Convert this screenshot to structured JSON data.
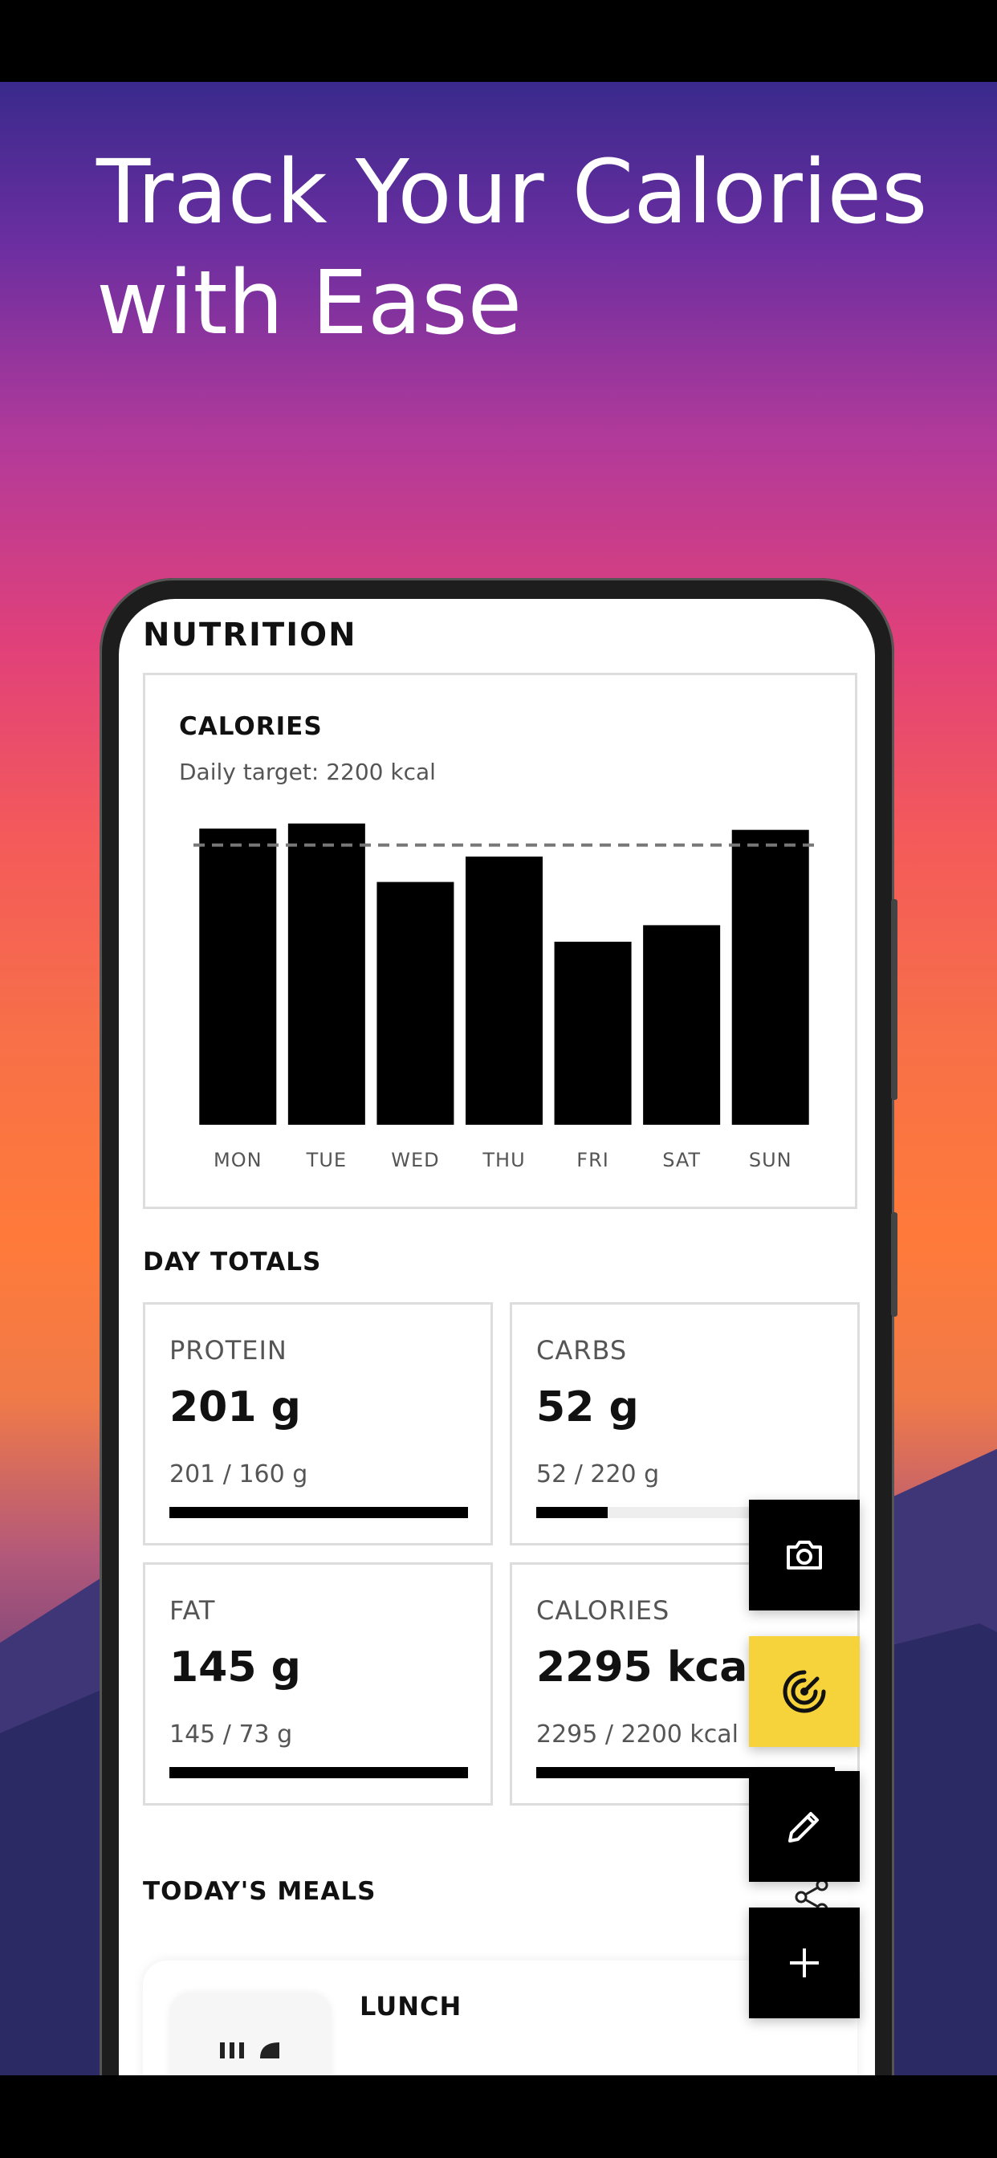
{
  "headline": {
    "line1": "Track Your Calories",
    "line2": "with Ease"
  },
  "app": {
    "title": "NUTRITION",
    "calories_card": {
      "title": "CALORIES",
      "subtitle": "Daily target: 2200 kcal"
    },
    "day_totals": {
      "label": "DAY TOTALS",
      "tiles": [
        {
          "label": "PROTEIN",
          "value": "201 g",
          "detail": "201 / 160 g",
          "progress": 1.0
        },
        {
          "label": "CARBS",
          "value": "52 g",
          "detail": "52 / 220 g",
          "progress": 0.24
        },
        {
          "label": "FAT",
          "value": "145 g",
          "detail": "145 / 73 g",
          "progress": 1.0
        },
        {
          "label": "CALORIES",
          "value": "2295 kcal",
          "detail": "2295 / 2200 kcal",
          "progress": 1.0
        }
      ]
    },
    "meals": {
      "label": "TODAY'S MEALS",
      "items": [
        {
          "title": "LUNCH"
        }
      ]
    }
  },
  "fabs": [
    {
      "name": "camera",
      "icon": "camera-icon"
    },
    {
      "name": "target",
      "icon": "target-icon",
      "color": "#f6d33a"
    },
    {
      "name": "edit",
      "icon": "pencil-icon"
    },
    {
      "name": "add",
      "icon": "plus-icon"
    }
  ],
  "chart_data": {
    "type": "bar",
    "title": "CALORIES",
    "categories": [
      "MON",
      "TUE",
      "WED",
      "THU",
      "FRI",
      "SAT",
      "SUN"
    ],
    "values": [
      2330,
      2370,
      1910,
      2110,
      1440,
      1570,
      2320
    ],
    "target": 2200,
    "ylim": [
      0,
      2400
    ],
    "grid": false
  }
}
